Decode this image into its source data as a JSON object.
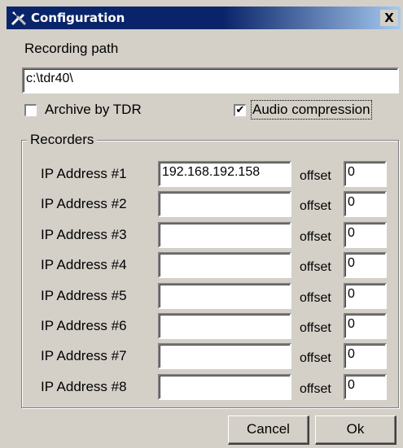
{
  "window": {
    "title": "Configuration",
    "icon": "configuration-tools-icon",
    "close_label": "X"
  },
  "recording_path": {
    "label": "Recording path",
    "value": "c:\\tdr40\\"
  },
  "options": {
    "archive": {
      "label": "Archive by TDR",
      "checked": false
    },
    "audio": {
      "label": "Audio compression",
      "checked": true
    }
  },
  "recorders": {
    "title": "Recorders",
    "offset_label": "offset",
    "rows": [
      {
        "label": "IP Address #1",
        "ip": "192.168.192.158",
        "offset": "0"
      },
      {
        "label": "IP Address #2",
        "ip": "",
        "offset": "0"
      },
      {
        "label": "IP Address #3",
        "ip": "",
        "offset": "0"
      },
      {
        "label": "IP Address #4",
        "ip": "",
        "offset": "0"
      },
      {
        "label": "IP Address #5",
        "ip": "",
        "offset": "0"
      },
      {
        "label": "IP Address #6",
        "ip": "",
        "offset": "0"
      },
      {
        "label": "IP Address #7",
        "ip": "",
        "offset": "0"
      },
      {
        "label": "IP Address #8",
        "ip": "",
        "offset": "0"
      }
    ]
  },
  "buttons": {
    "cancel": "Cancel",
    "ok": "Ok"
  },
  "colors": {
    "titlebar_start": "#0a246a",
    "titlebar_end": "#a6caf0",
    "face": "#d4d0c8"
  }
}
